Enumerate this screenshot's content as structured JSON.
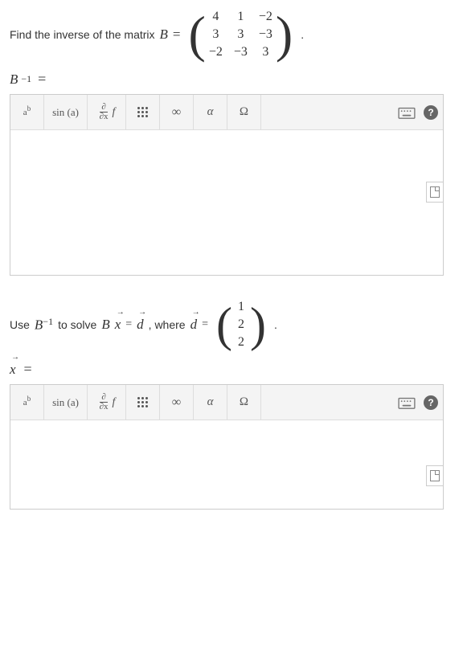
{
  "q1": {
    "prefix": "Find the inverse of the matrix",
    "var": "B",
    "eq": "=",
    "matrix": [
      "4",
      "1",
      "−2",
      "3",
      "3",
      "−3",
      "−2",
      "−3",
      "3"
    ],
    "period": ".",
    "label_var": "B",
    "label_sup": "−1",
    "label_eq": "="
  },
  "q2": {
    "prefix": "Use",
    "Bvar": "B",
    "Bsup": "−1",
    "mid1": "to solve",
    "eqB": "B",
    "eqx": "x",
    "eq": "=",
    "dvar": "d",
    "mid2": ", where",
    "dvar2": "d",
    "eq2": "=",
    "vector": [
      "1",
      "2",
      "2"
    ],
    "period": ".",
    "label_var": "x",
    "label_eq": "="
  },
  "toolbar": {
    "ab_a": "a",
    "ab_b": "b",
    "sin": "sin (a)",
    "deriv_num": "∂",
    "deriv_den": "∂x",
    "deriv_f": "f",
    "inf": "∞",
    "alpha": "α",
    "omega": "Ω",
    "help": "?"
  }
}
